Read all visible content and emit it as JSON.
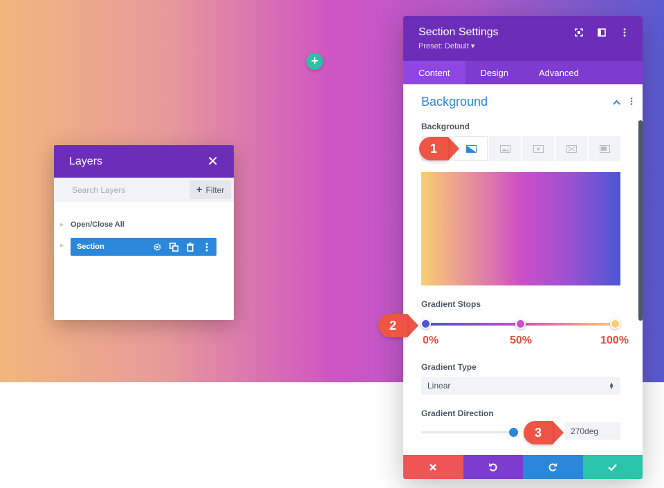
{
  "layers": {
    "title": "Layers",
    "search_placeholder": "Search Layers",
    "filter_label": "Filter",
    "open_close_label": "Open/Close All",
    "section_label": "Section"
  },
  "settings": {
    "title": "Section Settings",
    "preset": "Preset: Default ▾",
    "tabs": [
      "Content",
      "Design",
      "Advanced"
    ],
    "group_title": "Background",
    "background_label": "Background",
    "background_types": [
      "color-icon",
      "gradient-icon",
      "image-icon",
      "video-icon",
      "pattern-icon",
      "mask-icon"
    ],
    "gradient_stops_label": "Gradient Stops",
    "gradient_stops": [
      {
        "label": "0%",
        "color": "#4a56d6"
      },
      {
        "label": "50%",
        "color": "#cd4fc7"
      },
      {
        "label": "100%",
        "color": "#f9cf72"
      }
    ],
    "gradient_type_label": "Gradient Type",
    "gradient_type_value": "Linear",
    "gradient_direction_label": "Gradient Direction",
    "gradient_direction_value": "270deg",
    "gradient_direction_fraction": 1.0
  },
  "callouts": [
    "1",
    "2",
    "3"
  ],
  "colors": {
    "purple": "#6c2eb9",
    "blue": "#2b87da",
    "teal": "#2fbfa5",
    "red": "#ef5545",
    "cancel": "#ef5555",
    "undo": "#7e3bd0",
    "redo": "#2b87da",
    "save": "#29c4a9"
  }
}
